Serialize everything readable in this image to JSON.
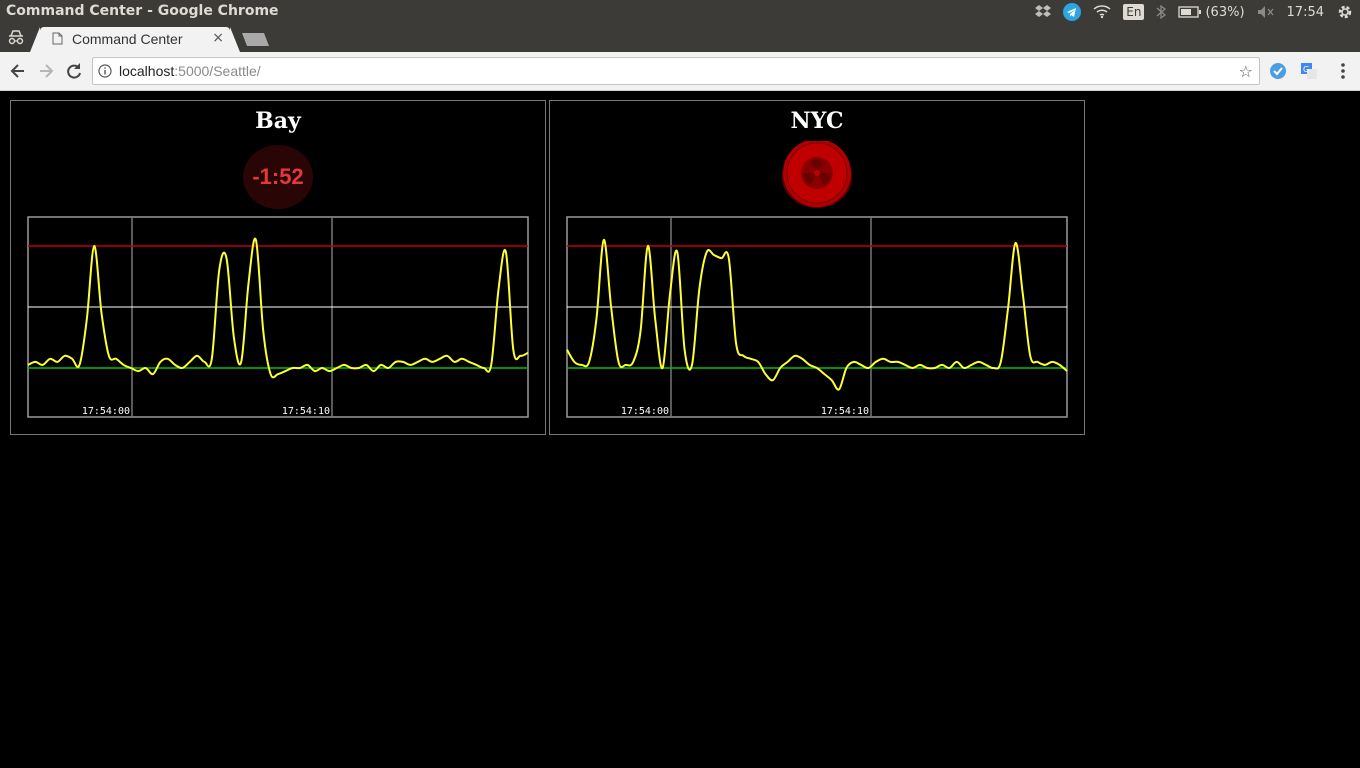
{
  "window": {
    "title": "Command Center - Google Chrome"
  },
  "tray": {
    "language": "En",
    "battery": "(63%)",
    "clock": "17:54"
  },
  "tab": {
    "title": "Command Center",
    "close": "×"
  },
  "address": {
    "host": "localhost",
    "rest": ":5000/Seattle/"
  },
  "panels": [
    {
      "title": "Bay",
      "status": "-1:52",
      "chart_data": {
        "type": "line",
        "x_ticks": [
          "17:54:00",
          "17:54:10"
        ],
        "thresholds": {
          "upper_color": "#c00000",
          "mid_color": "#ffffff",
          "lower_color": "#00c000"
        },
        "line_color": "#ffff33",
        "values": [
          0.05,
          0.1,
          0.05,
          0.15,
          0.1,
          0.2,
          0.15,
          0.05,
          0.8,
          2.0,
          0.9,
          0.2,
          0.15,
          0.05,
          0.0,
          -0.05,
          0.0,
          -0.1,
          0.1,
          0.15,
          0.05,
          0.0,
          0.1,
          0.2,
          0.1,
          0.15,
          1.6,
          1.8,
          0.5,
          0.1,
          1.4,
          2.1,
          0.6,
          -0.1,
          -0.1,
          -0.05,
          0.0,
          0.0,
          0.05,
          -0.05,
          0.0,
          -0.05,
          0.0,
          0.05,
          0.0,
          0.0,
          0.05,
          -0.05,
          0.05,
          0.0,
          0.1,
          0.1,
          0.05,
          0.1,
          0.15,
          0.1,
          0.15,
          0.2,
          0.1,
          0.15,
          0.1,
          0.05,
          0.0,
          0.05,
          1.3,
          1.9,
          0.3,
          0.2,
          0.25
        ]
      }
    },
    {
      "title": "NYC",
      "status_icon": "radiation-alarm-button",
      "chart_data": {
        "type": "line",
        "x_ticks": [
          "17:54:00",
          "17:54:10"
        ],
        "thresholds": {
          "upper_color": "#c00000",
          "mid_color": "#ffffff",
          "lower_color": "#00c000"
        },
        "line_color": "#ffff33",
        "values": [
          0.3,
          0.1,
          0.05,
          0.1,
          0.8,
          2.1,
          1.0,
          0.1,
          0.05,
          0.1,
          0.6,
          2.0,
          0.8,
          0.0,
          1.2,
          1.9,
          0.3,
          0.05,
          1.3,
          1.9,
          1.85,
          1.8,
          1.8,
          0.4,
          0.2,
          0.15,
          0.1,
          -0.1,
          -0.2,
          0.0,
          0.1,
          0.2,
          0.15,
          0.05,
          0.0,
          -0.1,
          -0.2,
          -0.35,
          0.0,
          0.1,
          0.05,
          0.0,
          0.1,
          0.15,
          0.1,
          0.1,
          0.05,
          0.0,
          0.05,
          0.0,
          0.0,
          0.05,
          0.0,
          0.1,
          0.0,
          0.05,
          0.1,
          0.05,
          0.0,
          0.1,
          1.0,
          2.05,
          1.2,
          0.2,
          0.1,
          0.05,
          0.1,
          0.05,
          -0.05
        ]
      }
    }
  ]
}
